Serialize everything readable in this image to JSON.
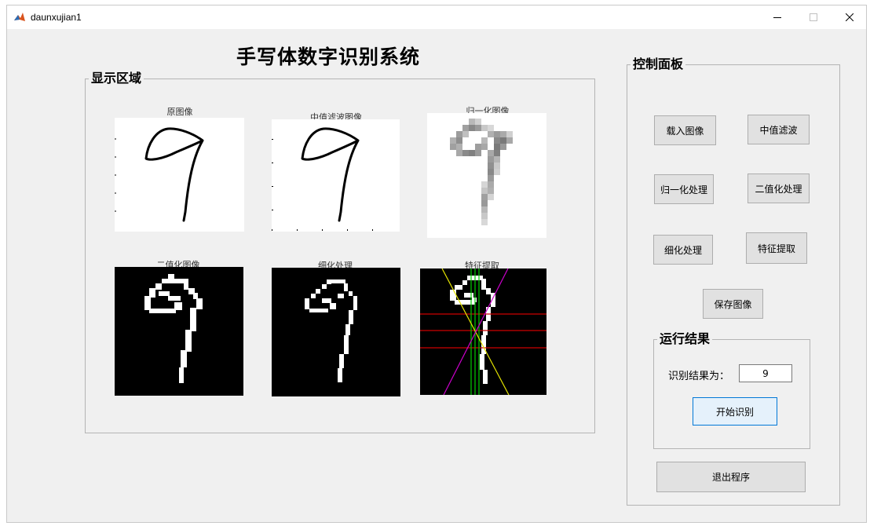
{
  "window": {
    "title": "daunxujian1"
  },
  "main_title": "手写体数字识别系统",
  "display": {
    "legend": "显示区域",
    "images": {
      "original": "原图像",
      "median": "中值滤波图像",
      "normalized": "归一化图像",
      "binary": "二值化图像",
      "thinned": "细化处理",
      "features": "特征提取"
    }
  },
  "control": {
    "legend": "控制面板",
    "buttons": {
      "load": "载入图像",
      "median": "中值滤波",
      "normalize": "归一化处理",
      "binarize": "二值化处理",
      "thin": "细化处理",
      "feature": "特征提取",
      "save": "保存图像"
    }
  },
  "result": {
    "legend": "运行结果",
    "label": "识别结果为：",
    "value": "9",
    "start_button": "开始识别"
  },
  "exit_button": "退出程序",
  "colors": {
    "window_bg": "#f0f0f0",
    "accent": "#0078d7",
    "feature_red": "#cc0000",
    "feature_green": "#00cc00",
    "feature_yellow": "#e6e600",
    "feature_magenta": "#cc00cc"
  }
}
